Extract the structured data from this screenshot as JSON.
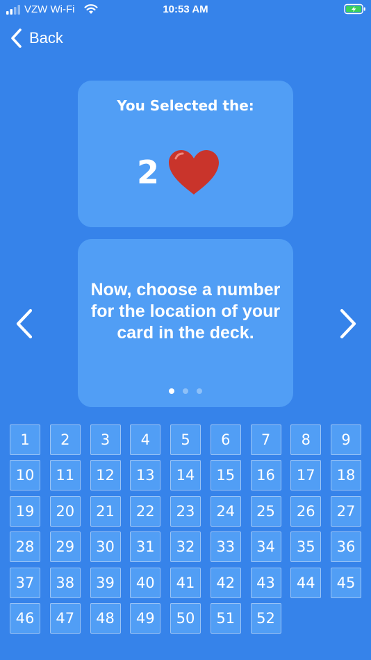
{
  "status_bar": {
    "carrier": "VZW Wi-Fi",
    "time": "10:53 AM"
  },
  "nav": {
    "back_label": "Back"
  },
  "selection": {
    "heading": "You Selected the:",
    "rank": "2",
    "suit_icon": "heart-icon"
  },
  "instruction": {
    "text": "Now, choose a number for the location of your card in the deck.",
    "page_count": 3,
    "active_page": 1
  },
  "numbers": [
    "1",
    "2",
    "3",
    "4",
    "5",
    "6",
    "7",
    "8",
    "9",
    "10",
    "11",
    "12",
    "13",
    "14",
    "15",
    "16",
    "17",
    "18",
    "19",
    "20",
    "21",
    "22",
    "23",
    "24",
    "25",
    "26",
    "27",
    "28",
    "29",
    "30",
    "31",
    "32",
    "33",
    "34",
    "35",
    "36",
    "37",
    "38",
    "39",
    "40",
    "41",
    "42",
    "43",
    "44",
    "45",
    "46",
    "47",
    "48",
    "49",
    "50",
    "51",
    "52"
  ],
  "colors": {
    "background": "#3683ea",
    "card": "#519ef5",
    "heart": "#c9342b",
    "battery_fill": "#3bd15a"
  }
}
